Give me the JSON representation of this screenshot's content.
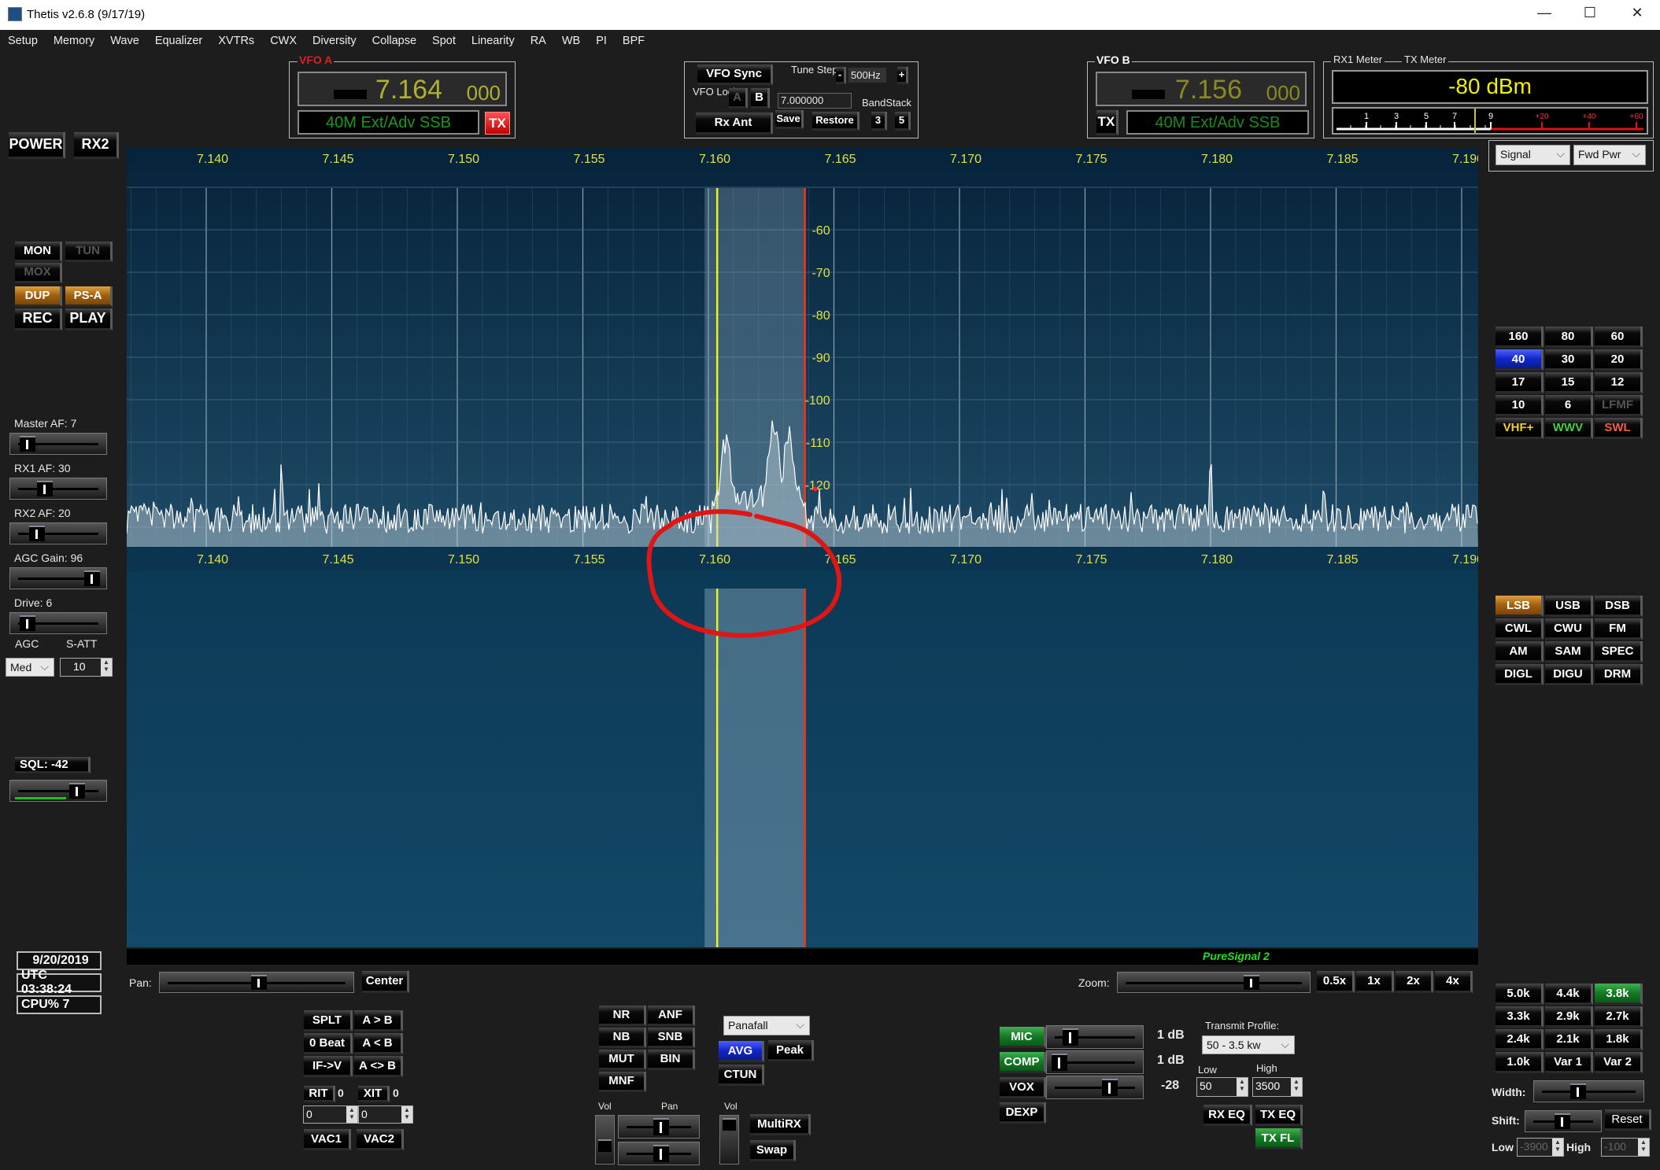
{
  "window": {
    "title": "Thetis v2.6.8 (9/17/19)",
    "minimize": "—",
    "maximize": "☐",
    "close": "✕"
  },
  "menu": [
    "Setup",
    "Memory",
    "Wave",
    "Equalizer",
    "XVTRs",
    "CWX",
    "Diversity",
    "Collapse",
    "Spot",
    "Linearity",
    "RA",
    "WB",
    "PI",
    "BPF"
  ],
  "left": {
    "power": "POWER",
    "rx2": "RX2",
    "mon": "MON",
    "tun": "TUN",
    "mox": "MOX",
    "dup": "DUP",
    "psa": "PS-A",
    "rec": "REC",
    "play": "PLAY",
    "sliders": [
      {
        "label": "Master AF:  7",
        "value": 7
      },
      {
        "label": "RX1 AF:  30",
        "value": 30
      },
      {
        "label": "RX2 AF:  20",
        "value": 20
      },
      {
        "label": "AGC Gain:  96",
        "value": 96
      },
      {
        "label": "Drive:  6",
        "value": 6
      }
    ],
    "agc_label": "AGC",
    "satt_label": "S-ATT",
    "agc_value": "Med",
    "satt_value": "10",
    "sql_label": "SQL: -42",
    "sql_value": -42,
    "date": "9/20/2019",
    "utc": "UTC 03:38:24",
    "cpu": "CPU%  7"
  },
  "vfo_a": {
    "title": "VFO A",
    "freq_main": "7.164",
    "freq_sub": "000",
    "mode": "40M Ext/Adv SSB",
    "tx": "TX"
  },
  "vfo_b": {
    "title": "VFO B",
    "freq_main": "7.156",
    "freq_sub": "000",
    "mode": "40M Ext/Adv SSB",
    "tx": "TX"
  },
  "vfo_ctrl": {
    "sync": "VFO Sync",
    "tune_step_label": "Tune Step:",
    "step_minus": "-",
    "step": "500Hz",
    "step_plus": "+",
    "lock_label": "VFO Lock:",
    "lock_a": "A",
    "lock_b": "B",
    "freq_input": "7.000000",
    "bandstack_label": "BandStack",
    "rx_ant": "Rx Ant",
    "save": "Save",
    "restore": "Restore",
    "bs1": "3",
    "bs2": "5"
  },
  "meter": {
    "rx_label": "RX1 Meter",
    "tx_label": "TX Meter",
    "reading": "-80 dBm",
    "scale": [
      "1",
      "3",
      "5",
      "7",
      "9",
      "+20",
      "+40",
      "+60"
    ],
    "rx_mode": "Signal",
    "tx_mode": "Fwd Pwr"
  },
  "spectrum": {
    "freq_labels": [
      "7.140",
      "7.145",
      "7.150",
      "7.155",
      "7.160",
      "7.165",
      "7.170",
      "7.175",
      "7.180",
      "7.185",
      "7.190"
    ],
    "db_labels": [
      "-60",
      "-70",
      "-80",
      "-90",
      "-100",
      "-110",
      "-120"
    ],
    "noise_floor_dbm": -128,
    "peaks": [
      {
        "mhz": 7.143,
        "dbm": -111
      },
      {
        "mhz": 7.1445,
        "dbm": -118
      },
      {
        "mhz": 7.18,
        "dbm": -111
      },
      {
        "mhz": 7.1607,
        "dbm": -110
      },
      {
        "mhz": 7.1626,
        "dbm": -106
      },
      {
        "mhz": 7.1632,
        "dbm": -108
      }
    ],
    "passband_hz": [
      -3900,
      -100
    ],
    "vfo_mhz": 7.164,
    "footer": "PureSignal 2",
    "colors": {
      "grid_text": "#e0e040",
      "passband_edge": "#ff3010",
      "cursor": "#f0f020",
      "annotation": "#e01515"
    }
  },
  "bands": [
    {
      "label": "160"
    },
    {
      "label": "80"
    },
    {
      "label": "60"
    },
    {
      "label": "40",
      "state": "bl"
    },
    {
      "label": "30"
    },
    {
      "label": "20"
    },
    {
      "label": "17"
    },
    {
      "label": "15"
    },
    {
      "label": "12"
    },
    {
      "label": "10"
    },
    {
      "label": "6"
    },
    {
      "label": "LFMF",
      "state": "dim"
    },
    {
      "label": "VHF+",
      "state": "y"
    },
    {
      "label": "WWV",
      "state": "g"
    },
    {
      "label": "SWL",
      "state": "r"
    }
  ],
  "modes": [
    {
      "label": "LSB",
      "state": "or"
    },
    {
      "label": "USB"
    },
    {
      "label": "DSB"
    },
    {
      "label": "CWL"
    },
    {
      "label": "CWU"
    },
    {
      "label": "FM"
    },
    {
      "label": "AM"
    },
    {
      "label": "SAM"
    },
    {
      "label": "SPEC"
    },
    {
      "label": "DIGL"
    },
    {
      "label": "DIGU"
    },
    {
      "label": "DRM"
    }
  ],
  "filters": [
    {
      "label": "5.0k"
    },
    {
      "label": "4.4k"
    },
    {
      "label": "3.8k",
      "state": "gr"
    },
    {
      "label": "3.3k"
    },
    {
      "label": "2.9k"
    },
    {
      "label": "2.7k"
    },
    {
      "label": "2.4k"
    },
    {
      "label": "2.1k"
    },
    {
      "label": "1.8k"
    },
    {
      "label": "1.0k"
    },
    {
      "label": "Var 1"
    },
    {
      "label": "Var 2"
    }
  ],
  "bottom": {
    "pan_label": "Pan:",
    "center": "Center",
    "vfo_buttons": [
      "SPLT",
      "A > B",
      "0 Beat",
      "A < B",
      "IF->V",
      "A <> B"
    ],
    "rit": "RIT",
    "rit_val": "0",
    "xit": "XIT",
    "xit_val": "0",
    "rit_input": "0",
    "xit_input": "0",
    "vac1": "VAC1",
    "vac2": "VAC2",
    "dsp": [
      "NR",
      "ANF",
      "NB",
      "SNB",
      "MUT",
      "BIN",
      "MNF"
    ],
    "display_mode": "Panafall",
    "avg": "AVG",
    "peak": "Peak",
    "ctun": "CTUN",
    "vol": "Vol",
    "pan": "Pan",
    "vol2": "Vol",
    "multirx": "MultiRX",
    "swap": "Swap",
    "mic": "MIC",
    "mic_val": "1 dB",
    "comp": "COMP",
    "comp_val": "1 dB",
    "vox": "VOX",
    "vox_val": "-28",
    "dexp": "DEXP",
    "tx_profile_label": "Transmit Profile:",
    "tx_profile": "50 - 3.5 kw",
    "low_label": "Low",
    "high_label": "High",
    "low": "50",
    "high": "3500",
    "rx_eq": "RX EQ",
    "tx_eq": "TX EQ",
    "tx_fl": "TX FL",
    "zoom_label": "Zoom:",
    "zooms": [
      "0.5x",
      "1x",
      "2x",
      "4x"
    ],
    "width_label": "Width:",
    "shift_label": "Shift:",
    "reset": "Reset",
    "flow_label": "Low",
    "fhigh_label": "High",
    "flow": "-3900",
    "fhigh": "-100"
  }
}
